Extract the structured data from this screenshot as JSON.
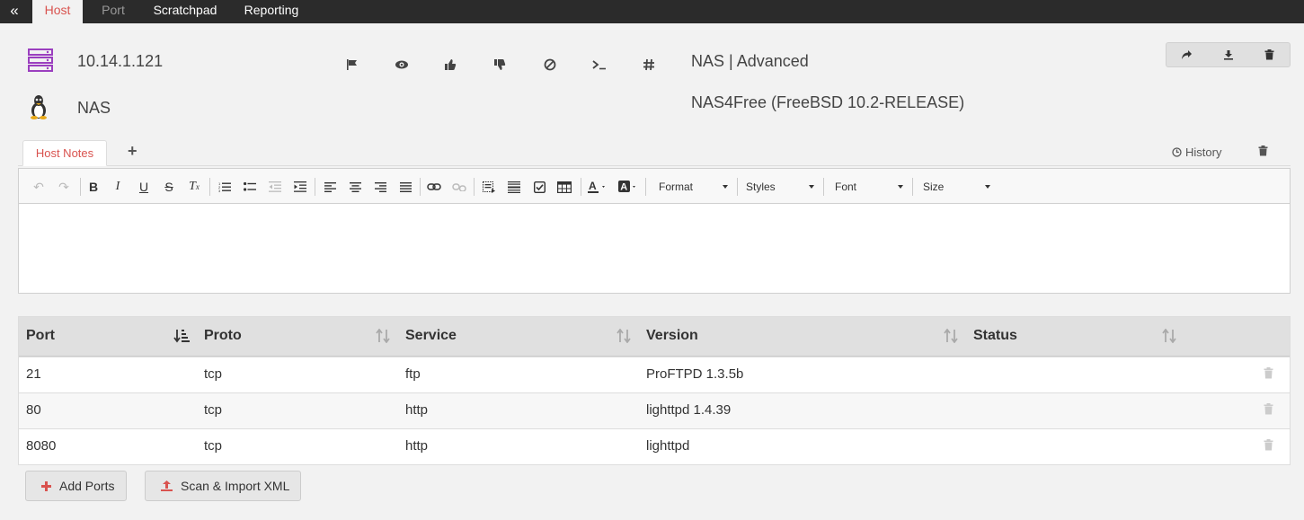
{
  "nav": {
    "collapse_icon": "double-chevron-left-icon",
    "tabs": [
      {
        "label": "Host",
        "state": "active"
      },
      {
        "label": "Port",
        "state": "muted"
      },
      {
        "label": "Scratchpad",
        "state": "normal"
      },
      {
        "label": "Reporting",
        "state": "normal"
      }
    ]
  },
  "host": {
    "ip": "10.14.1.121",
    "name": "NAS",
    "title": "NAS | Advanced",
    "os": "NAS4Free (FreeBSD 10.2-RELEASE)",
    "server_icon": "server-icon",
    "os_icon": "linux-tux-icon",
    "actions": [
      "flag-icon",
      "eye-icon",
      "thumbs-up-icon",
      "thumbs-down-icon",
      "ban-icon",
      "terminal-icon",
      "hash-icon"
    ],
    "right_actions": [
      "share-icon",
      "download-icon",
      "trash-icon"
    ]
  },
  "notes": {
    "tab_label": "Host Notes",
    "add_label": "+",
    "history_label": "History",
    "toolbar": {
      "format_label": "Format",
      "styles_label": "Styles",
      "font_label": "Font",
      "size_label": "Size"
    }
  },
  "ports": {
    "columns": [
      "Port",
      "Proto",
      "Service",
      "Version",
      "Status"
    ],
    "rows": [
      {
        "port": "21",
        "proto": "tcp",
        "service": "ftp",
        "version": "ProFTPD 1.3.5b",
        "status": ""
      },
      {
        "port": "80",
        "proto": "tcp",
        "service": "http",
        "version": "lighttpd 1.4.39",
        "status": ""
      },
      {
        "port": "8080",
        "proto": "tcp",
        "service": "http",
        "version": "lighttpd",
        "status": ""
      }
    ]
  },
  "buttons": {
    "add_ports": "Add Ports",
    "scan_import": "Scan & Import XML"
  },
  "colors": {
    "accent": "#d9534f",
    "server_icon": "#9b3fbf",
    "topbar": "#2b2b2b"
  }
}
